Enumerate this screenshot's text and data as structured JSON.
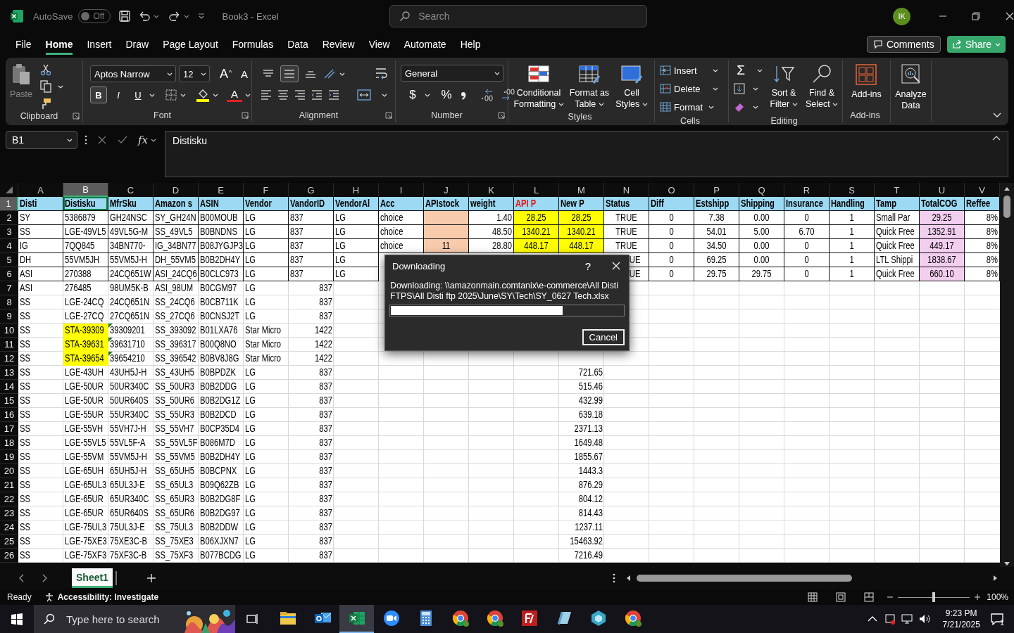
{
  "title_bar": {
    "autosave_label": "AutoSave",
    "autosave": {
      "on": false,
      "label": "Off"
    },
    "title": "Book3  -  Excel",
    "search": {
      "placeholder": "Search"
    },
    "avatar": "IK"
  },
  "menu_tabs": [
    {
      "label": "File",
      "selected": false
    },
    {
      "label": "Home",
      "selected": true
    },
    {
      "label": "Insert",
      "selected": false
    },
    {
      "label": "Draw",
      "selected": false
    },
    {
      "label": "Page Layout",
      "selected": false
    },
    {
      "label": "Formulas",
      "selected": false
    },
    {
      "label": "Data",
      "selected": false
    },
    {
      "label": "Review",
      "selected": false
    },
    {
      "label": "View",
      "selected": false
    },
    {
      "label": "Automate",
      "selected": false
    },
    {
      "label": "Help",
      "selected": false
    }
  ],
  "comments_button": "Comments",
  "share_button": "Share",
  "ribbon": {
    "clipboard": {
      "paste": "Paste",
      "title": "Clipboard"
    },
    "font": {
      "name": "Aptos Narrow",
      "size": "12",
      "grow": "A",
      "shrink": "A",
      "styles": [
        {
          "label": "B",
          "kind": "bold",
          "selected": true
        },
        {
          "label": "I",
          "kind": "italic",
          "selected": false
        },
        {
          "label": "U",
          "kind": "underline",
          "selected": false
        }
      ],
      "font_color": "A",
      "title": "Font"
    },
    "alignment": {
      "vertical": [
        {
          "kind": "top",
          "selected": false
        },
        {
          "kind": "middle",
          "selected": true
        },
        {
          "kind": "bottom",
          "selected": false
        }
      ],
      "title": "Alignment"
    },
    "number": {
      "format": "General",
      "currency": "$",
      "percent": "%",
      "title": "Number"
    },
    "styles": {
      "buttons": [
        "Conditional Formatting",
        "Format as Table",
        "Cell Styles"
      ],
      "title": "Styles"
    },
    "cells": {
      "buttons": [
        "Insert",
        "Delete",
        "Format"
      ],
      "title": "Cells"
    },
    "editing": {
      "autosum": "Σ",
      "buttons": [
        "Sort & Filter",
        "Find & Select"
      ],
      "title": "Editing"
    },
    "addins": {
      "button": "Add-ins",
      "title": "Add-ins"
    },
    "analyze": {
      "button": "Analyze Data"
    }
  },
  "formula_bar": {
    "name_box": "B1",
    "fx": "fx",
    "value": "Distisku"
  },
  "grid": {
    "columns": [
      {
        "label": "A",
        "selected": false
      },
      {
        "label": "B",
        "selected": true
      },
      {
        "label": "C",
        "selected": false
      },
      {
        "label": "D",
        "selected": false
      },
      {
        "label": "E",
        "selected": false
      },
      {
        "label": "F",
        "selected": false
      },
      {
        "label": "G",
        "selected": false
      },
      {
        "label": "H",
        "selected": false
      },
      {
        "label": "I",
        "selected": false
      },
      {
        "label": "J",
        "selected": false
      },
      {
        "label": "K",
        "selected": false
      },
      {
        "label": "L",
        "selected": false
      },
      {
        "label": "M",
        "selected": false
      },
      {
        "label": "N",
        "selected": false
      },
      {
        "label": "O",
        "selected": false
      },
      {
        "label": "P",
        "selected": false
      },
      {
        "label": "Q",
        "selected": false
      },
      {
        "label": "R",
        "selected": false
      },
      {
        "label": "S",
        "selected": false
      },
      {
        "label": "T",
        "selected": false
      },
      {
        "label": "U",
        "selected": false
      },
      {
        "label": "V",
        "selected": false
      }
    ],
    "rows": [
      {
        "n": "1",
        "selected": true,
        "kind": "header",
        "cells": [
          "Disti",
          "Distisku",
          "MfrSku",
          "Amazon s",
          "ASIN",
          "Vendor",
          "VandorID",
          "VendorAl",
          "Acc",
          "APIstock",
          "weight",
          {
            "v": "API P",
            "alert": true
          },
          "New P",
          "Status",
          "Diff",
          "Estshipp",
          "Shipping",
          "Insurance",
          "Handling",
          "Tamp",
          "TotalCOG",
          "Reffee"
        ]
      },
      {
        "n": "2",
        "selected": false,
        "kind": "bordered",
        "cells": [
          "SY",
          "5386879",
          "GH24NSC",
          "SY_GH24N",
          "B00MOUB",
          "LG",
          "837",
          "LG",
          "choice",
          {
            "color": "#f8cbad"
          },
          "1.40",
          {
            "v": "28.25",
            "color": "#ffff00"
          },
          {
            "v": "28.25",
            "color": "#ffff00"
          },
          "TRUE",
          "0",
          "7.38",
          "0.00",
          "0",
          "1",
          "Small Par",
          {
            "v": "29.25",
            "color": "#f2ceef"
          },
          "8%"
        ]
      },
      {
        "n": "3",
        "selected": false,
        "kind": "bordered",
        "cells": [
          "SS",
          "LGE-49VL5",
          "49VL5G-M",
          "SS_49VL5",
          "B0BNDNS",
          "LG",
          "837",
          "LG",
          "choice",
          {
            "color": "#f8cbad"
          },
          "48.50",
          {
            "v": "1340.21",
            "color": "#ffff00"
          },
          {
            "v": "1340.21",
            "color": "#ffff00"
          },
          "TRUE",
          "0",
          "54.01",
          "5.00",
          "6.70",
          "1",
          "Quick Free",
          {
            "v": "1352.91",
            "color": "#f2ceef"
          },
          "8%"
        ]
      },
      {
        "n": "4",
        "selected": false,
        "kind": "bordered",
        "cells": [
          "IG",
          "7QQ845",
          "34BN770-",
          "IG_34BN77",
          "B08JYGJP3",
          "LG",
          "837",
          "LG",
          "choice",
          {
            "v": "11",
            "color": "#f8cbad"
          },
          "28.80",
          {
            "v": "448.17",
            "color": "#ffff00"
          },
          {
            "v": "448.17",
            "color": "#ffff00"
          },
          "TRUE",
          "0",
          "34.50",
          "0.00",
          "0",
          "1",
          "Quick Free",
          {
            "v": "449.17",
            "color": "#f2ceef"
          },
          "8%"
        ]
      },
      {
        "n": "5",
        "selected": false,
        "kind": "bordered",
        "cells": [
          "DH",
          "55VM5JH",
          "55VM5J-H",
          "DH_55VM5",
          "B0B2DH4Y",
          "LG",
          "837",
          "LG",
          null,
          null,
          null,
          null,
          null,
          {
            "v": "UE",
            "cut": true
          },
          "0",
          "69.25",
          "0.00",
          "0",
          "1",
          "LTL Shippi",
          {
            "v": "1838.67",
            "color": "#f2ceef"
          },
          "8%"
        ]
      },
      {
        "n": "6",
        "selected": false,
        "kind": "bordered",
        "cells": [
          "ASI",
          "270388",
          "24CQ651W",
          "ASI_24CQ6",
          "B0CLC973",
          "LG",
          "837",
          "LG",
          null,
          null,
          null,
          null,
          null,
          {
            "v": "UE",
            "cut": true
          },
          "0",
          "29.75",
          "29.75",
          "0",
          "1",
          "Quick Free",
          {
            "v": "660.10",
            "color": "#f2ceef"
          },
          "8%"
        ]
      },
      {
        "n": "7",
        "selected": false,
        "kind": "plain",
        "cells": [
          "ASI",
          "276485",
          "98UM5K-B",
          "ASI_98UM",
          "B0CGM97",
          "LG",
          "837"
        ]
      },
      {
        "n": "8",
        "selected": false,
        "kind": "plain",
        "cells": [
          "SS",
          "LGE-24CQ",
          "24CQ651N",
          "SS_24CQ6",
          "B0CB711K",
          "LG",
          "837"
        ]
      },
      {
        "n": "9",
        "selected": false,
        "kind": "plain",
        "cells": [
          "SS",
          "LGE-27CQ",
          "27CQ651N",
          "SS_27CQ6",
          "B0CNSJ2T",
          "LG",
          "837"
        ]
      },
      {
        "n": "10",
        "selected": false,
        "kind": "plain",
        "cells": [
          "SS",
          {
            "v": "STA-39309",
            "color": "#ffff00"
          },
          {
            "v": "39309201",
            "flag": true
          },
          "SS_393092",
          "B01LXA76",
          "Star Micro",
          "1422"
        ]
      },
      {
        "n": "11",
        "selected": false,
        "kind": "plain",
        "cells": [
          "SS",
          {
            "v": "STA-39631",
            "color": "#ffff00"
          },
          {
            "v": "39631710",
            "flag": true
          },
          "SS_396317",
          "B00Q8NO",
          "Star Micro",
          "1422"
        ]
      },
      {
        "n": "12",
        "selected": false,
        "kind": "plain",
        "cells": [
          "SS",
          {
            "v": "STA-39654",
            "color": "#ffff00"
          },
          {
            "v": "39654210",
            "flag": true
          },
          "SS_396542",
          "B0BV8J8G",
          "Star Micro",
          "1422"
        ]
      },
      {
        "n": "13",
        "selected": false,
        "kind": "plain",
        "cells": [
          "SS",
          "LGE-43UH",
          "43UH5J-H",
          "SS_43UH5",
          "B0BPDZK",
          "LG",
          "837",
          null,
          null,
          null,
          null,
          null,
          "721.65"
        ]
      },
      {
        "n": "14",
        "selected": false,
        "kind": "plain",
        "cells": [
          "SS",
          "LGE-50UR",
          "50UR340C",
          "SS_50UR3",
          "B0B2DDG",
          "LG",
          "837",
          null,
          null,
          null,
          null,
          null,
          "515.46"
        ]
      },
      {
        "n": "15",
        "selected": false,
        "kind": "plain",
        "cells": [
          "SS",
          "LGE-50UR",
          "50UR640S",
          "SS_50UR6",
          "B0B2DG1Z",
          "LG",
          "837",
          null,
          null,
          null,
          null,
          null,
          "432.99"
        ]
      },
      {
        "n": "16",
        "selected": false,
        "kind": "plain",
        "cells": [
          "SS",
          "LGE-55UR",
          "55UR340C",
          "SS_55UR3",
          "B0B2DCD",
          "LG",
          "837",
          null,
          null,
          null,
          null,
          null,
          "639.18"
        ]
      },
      {
        "n": "17",
        "selected": false,
        "kind": "plain",
        "cells": [
          "SS",
          "LGE-55VH",
          "55VH7J-H",
          "SS_55VH7",
          "B0CP35D4",
          "LG",
          "837",
          null,
          null,
          null,
          null,
          null,
          "2371.13"
        ]
      },
      {
        "n": "18",
        "selected": false,
        "kind": "plain",
        "cells": [
          "SS",
          "LGE-55VL5",
          "55VL5F-A",
          "SS_55VL5F",
          "B086M7D",
          "LG",
          "837",
          null,
          null,
          null,
          null,
          null,
          "1649.48"
        ]
      },
      {
        "n": "19",
        "selected": false,
        "kind": "plain",
        "cells": [
          "SS",
          "LGE-55VM",
          "55VM5J-H",
          "SS_55VM5",
          "B0B2DH4Y",
          "LG",
          "837",
          null,
          null,
          null,
          null,
          null,
          "1855.67"
        ]
      },
      {
        "n": "20",
        "selected": false,
        "kind": "plain",
        "cells": [
          "SS",
          "LGE-65UH",
          "65UH5J-H",
          "SS_65UH5",
          "B0BCPNX",
          "LG",
          "837",
          null,
          null,
          null,
          null,
          null,
          "1443.3"
        ]
      },
      {
        "n": "21",
        "selected": false,
        "kind": "plain",
        "cells": [
          "SS",
          "LGE-65UL3",
          "65UL3J-E",
          "SS_65UL3",
          "B09Q62ZB",
          "LG",
          "837",
          null,
          null,
          null,
          null,
          null,
          "876.29"
        ]
      },
      {
        "n": "22",
        "selected": false,
        "kind": "plain",
        "cells": [
          "SS",
          "LGE-65UR",
          "65UR340C",
          "SS_65UR3",
          "B0B2DG8F",
          "LG",
          "837",
          null,
          null,
          null,
          null,
          null,
          "804.12"
        ]
      },
      {
        "n": "23",
        "selected": false,
        "kind": "plain",
        "cells": [
          "SS",
          "LGE-65UR",
          "65UR640S",
          "SS_65UR6",
          "B0B2DG97",
          "LG",
          "837",
          null,
          null,
          null,
          null,
          null,
          "814.43"
        ]
      },
      {
        "n": "24",
        "selected": false,
        "kind": "plain",
        "cells": [
          "SS",
          "LGE-75UL3",
          "75UL3J-E",
          "SS_75UL3",
          "B0B2DDW",
          "LG",
          "837",
          null,
          null,
          null,
          null,
          null,
          "1237.11"
        ]
      },
      {
        "n": "25",
        "selected": false,
        "kind": "plain",
        "cells": [
          "SS",
          "LGE-75XE3",
          "75XE3C-B",
          "SS_75XE3",
          "B06XJXN7",
          "LG",
          "837",
          null,
          null,
          null,
          null,
          null,
          "15463.92"
        ]
      },
      {
        "n": "26",
        "selected": false,
        "kind": "plain",
        "cells": [
          "SS",
          "LGE-75XF3",
          "75XF3C-B",
          "SS_75XF3",
          "B077BCDG",
          "LG",
          "837",
          null,
          null,
          null,
          null,
          null,
          "7216.49"
        ]
      }
    ]
  },
  "dialog": {
    "title": "Downloading",
    "help": "?",
    "message": "Downloading: \\\\amazonmain.comtanix\\e-commerce\\All Disti FTPS\\All Disti ftp 2025\\June\\SY\\Tech\\SY_0627 Tech.xlsx",
    "progress": {
      "level": 0.74
    },
    "cancel": "Cancel"
  },
  "sheet_tabs": [
    {
      "label": "Sheet1",
      "selected": true
    }
  ],
  "status_bar": {
    "status": "Ready",
    "accessibility": "Accessibility: Investigate",
    "zoom": {
      "level": 0.5
    },
    "zoom_value": "100%"
  },
  "taskbar": {
    "search": {
      "placeholder": "Type here to search"
    },
    "apps": [
      {
        "kind": "folder",
        "selected": false
      },
      {
        "kind": "mail",
        "selected": false
      },
      {
        "kind": "sheet",
        "selected": true
      },
      {
        "kind": "meeting",
        "selected": false
      },
      {
        "kind": "calculator",
        "selected": false
      },
      {
        "kind": "browser",
        "selected": false
      },
      {
        "kind": "browser",
        "selected": false
      },
      {
        "kind": "ftp",
        "selected": false
      },
      {
        "kind": "notes",
        "selected": false
      },
      {
        "kind": "cube",
        "selected": false
      },
      {
        "kind": "browser",
        "selected": false
      }
    ],
    "time": "9:23 PM",
    "date": "7/21/2025",
    "notifications": "1"
  }
}
